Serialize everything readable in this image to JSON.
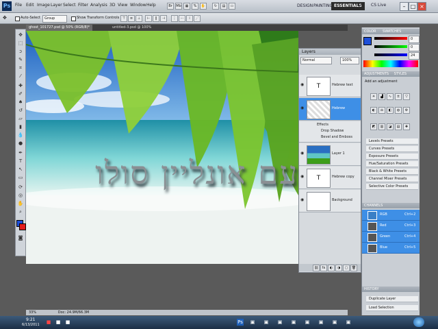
{
  "app": {
    "logo": "Ps",
    "colors": {
      "accent": "#3e8fe6",
      "menubar": "#c8ced5",
      "canvas_bg": "#4a4a4a"
    }
  },
  "menu": [
    "File",
    "Edit",
    "Image",
    "Layer",
    "Select",
    "Filter",
    "Analysis",
    "3D",
    "View",
    "Window",
    "Help"
  ],
  "workspaces": [
    "DESIGN",
    "PAINTING",
    "ESSENTIALS"
  ],
  "cs_live": "CS Live",
  "options": {
    "tool_option": "Auto-Select",
    "tool_mode": "Group",
    "show_transform": "Show Transform Controls"
  },
  "doc_tabs": [
    "ghost_101727.psd @ 50% (RGB/8)*",
    "untitled-3.psd @ 100%"
  ],
  "canvas": {
    "hebrew_text": "עם אונליין סולו"
  },
  "status": {
    "zoom": "33%",
    "doc": "Doc: 24.9M/66.3M"
  },
  "layers_panel": {
    "title": "Layers",
    "blend_mode": "Normal",
    "opacity": "100%",
    "layers": [
      {
        "name": "Hebrew text",
        "selected": false
      },
      {
        "name": "Hebrew",
        "selected": true
      },
      {
        "name": "Layer 1",
        "selected": false
      },
      {
        "name": "Hebrew copy",
        "selected": false
      },
      {
        "name": "Background",
        "selected": false
      }
    ],
    "effects": [
      "Effects",
      "Drop Shadow",
      "Bevel and Emboss"
    ]
  },
  "color_panel": {
    "tabs": [
      "COLOR",
      "SWATCHES"
    ],
    "values": [
      "0",
      "0",
      "24"
    ]
  },
  "adjust_panel": {
    "tabs": [
      "ADJUSTMENTS",
      "STYLES"
    ],
    "header": "Add an adjustment",
    "presets": [
      "Levels Presets",
      "Curves Presets",
      "Exposure Presets",
      "Hue/Saturation Presets",
      "Black & White Presets",
      "Channel Mixer Presets",
      "Selective Color Presets"
    ]
  },
  "channels_panel": {
    "title": "CHANNELS",
    "channels": [
      {
        "name": "RGB",
        "key": "Ctrl+2"
      },
      {
        "name": "Red",
        "key": "Ctrl+3"
      },
      {
        "name": "Green",
        "key": "Ctrl+4"
      },
      {
        "name": "Blue",
        "key": "Ctrl+5"
      }
    ]
  },
  "history_panel": {
    "title": "HISTORY",
    "items": [
      "Duplicate Layer",
      "Load Selection"
    ]
  },
  "taskbar": {
    "time": "9:21",
    "date": "6/13/2011"
  }
}
